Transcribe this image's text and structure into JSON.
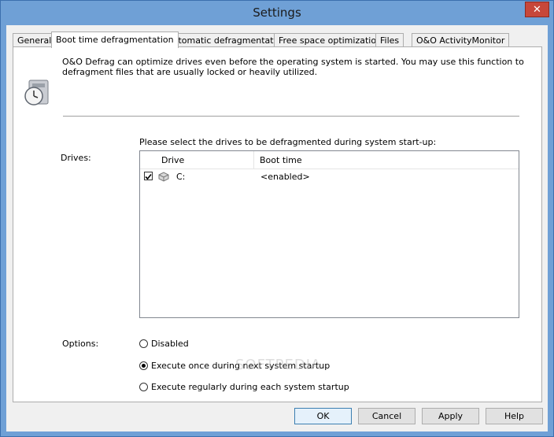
{
  "window": {
    "title": "Settings",
    "close_label": "✕"
  },
  "tabs": [
    {
      "label": "General"
    },
    {
      "label": "Boot time defragmentation",
      "active": true
    },
    {
      "label": "Automatic defragmentation"
    },
    {
      "label": "Free space optimizations"
    },
    {
      "label": "Files"
    },
    {
      "label": "O&O ActivityMonitor"
    }
  ],
  "panel": {
    "description": "O&O Defrag can optimize drives even before the operating system is started. You may use this function to defragment files that are usually locked or heavily utilized.",
    "drives_prompt": "Please select the drives to be defragmented during system start-up:",
    "drives_label": "Drives:",
    "columns": {
      "drive": "Drive",
      "boot_time": "Boot time"
    },
    "rows": [
      {
        "drive": "C:",
        "boot_time": "<enabled>",
        "checked": true
      }
    ],
    "options_label": "Options:",
    "options": [
      {
        "label": "Disabled",
        "selected": false
      },
      {
        "label": "Execute once during next system startup",
        "selected": true
      },
      {
        "label": "Execute regularly during each system startup",
        "selected": false
      }
    ]
  },
  "buttons": {
    "ok": "OK",
    "cancel": "Cancel",
    "apply": "Apply",
    "help": "Help"
  },
  "watermark": "SOFTPEDIA",
  "colors": {
    "titlebar": "#6fa0d6",
    "close": "#c7473a",
    "panel_bg": "#ffffff",
    "dialog_bg": "#f0f0f0"
  }
}
